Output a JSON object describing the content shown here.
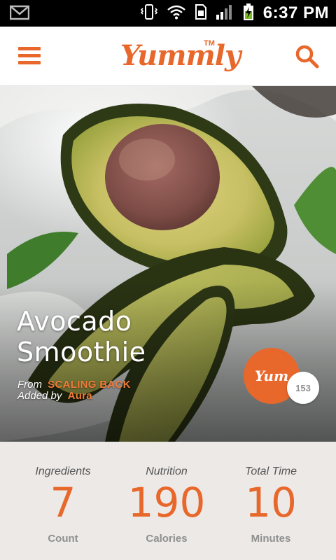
{
  "status_bar": {
    "time": "6:37 PM",
    "icons": [
      "gmail-icon",
      "vibrate-icon",
      "wifi-icon",
      "sim-icon",
      "signal-icon",
      "battery-charging-icon"
    ]
  },
  "app_bar": {
    "logo_text": "Yummly",
    "logo_tm": "TM",
    "menu_icon": "hamburger-menu-icon",
    "search_icon": "search-icon"
  },
  "recipe": {
    "title": "Avocado Smoothie",
    "from_label": "From",
    "from_source": "SCALING BACK",
    "added_label": "Added by",
    "added_by": "Aura",
    "yum_label": "Yum",
    "yum_count": "153"
  },
  "stats": [
    {
      "title": "Ingredients",
      "value": "7",
      "unit": "Count"
    },
    {
      "title": "Nutrition",
      "value": "190",
      "unit": "Calories"
    },
    {
      "title": "Total Time",
      "value": "10",
      "unit": "Minutes"
    }
  ],
  "colors": {
    "brand": "#e8672b",
    "background": "#ece9e7",
    "muted": "#8f8f8f"
  }
}
